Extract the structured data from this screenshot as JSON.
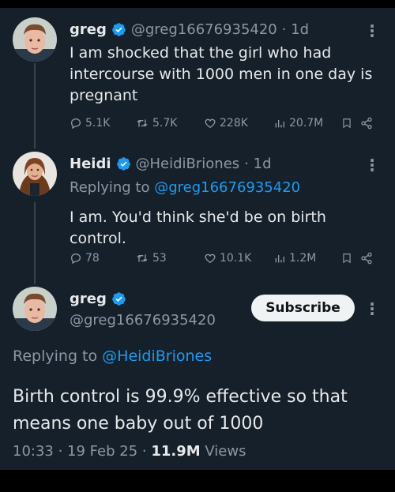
{
  "tweets": [
    {
      "name": "greg",
      "handle": "@greg16676935420",
      "time": "· 1d",
      "text": "I am shocked that the girl who had intercourse with 1000 men in one day is pregnant",
      "replies": "5.1K",
      "retweets": "5.7K",
      "likes": "228K",
      "views": "20.7M"
    },
    {
      "name": "Heidi",
      "handle": "@HeidiBriones",
      "time": "· 1d",
      "replying_prefix": "Replying to ",
      "replying_handle": "@greg16676935420",
      "text": "I am. You'd think she'd be on birth control.",
      "replies": "78",
      "retweets": "53",
      "likes": "10.1K",
      "views": "1.2M"
    }
  ],
  "main_tweet": {
    "name": "greg",
    "handle": "@greg16676935420",
    "subscribe_label": "Subscribe",
    "replying_prefix": "Replying to ",
    "replying_handle": "@HeidiBriones",
    "text": "Birth control is 99.9% effective so that means one baby out of 1000",
    "time": "10:33 · 19 Feb 25 · ",
    "views_count": "11.9M",
    "views_label": " Views"
  },
  "colors": {
    "background": "#15202b",
    "accent": "#1d9bf0",
    "muted": "#8b98a5"
  }
}
